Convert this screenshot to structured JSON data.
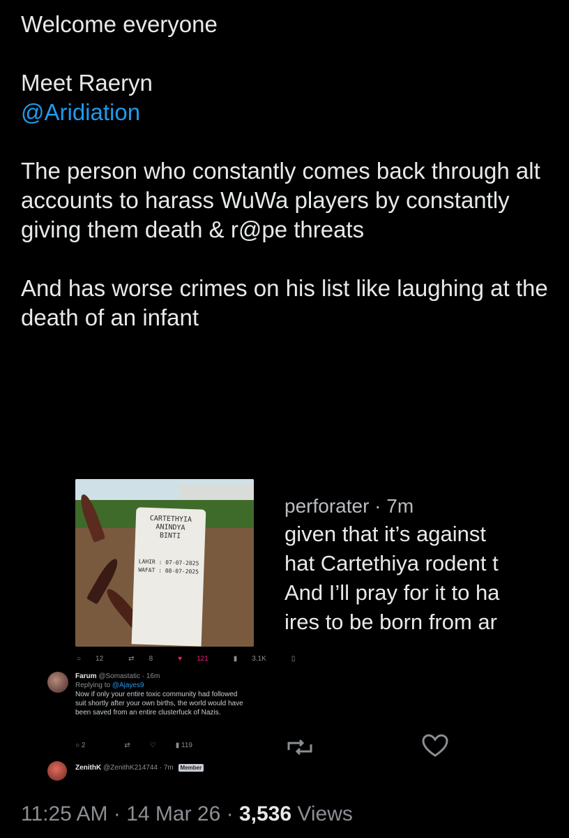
{
  "tweet": {
    "line1": "Welcome everyone",
    "line2": "Meet Raeryn",
    "mention": "@Aridiation",
    "para1": "The person who constantly comes back through alt accounts to harass WuWa players by constantly giving them death & r@pe threats",
    "para2": "And has worse crimes on his list like laughing at the death of an infant"
  },
  "embedded": {
    "gravestone": [
      "CARTETHYIA",
      "ANINDYA",
      "BINTI"
    ],
    "gravestone_dates": [
      "LAHIR : 07-07-2025",
      "WAFAT : 08-07-2025"
    ],
    "stats": {
      "replies": "12",
      "reposts": "8",
      "likes": "121",
      "views": "3.1K"
    },
    "reply": {
      "name": "Farum",
      "handle": "@Somastatic · 16m",
      "replying_label": "Replying to",
      "replying_handle": "@Ajayes9",
      "text": "Now if only your entire toxic community had followed suit shortly after your own births, the world would have been saved from an entire clusterfuck of Nazis."
    },
    "stats2": {
      "replies": "2",
      "views": "119"
    },
    "reply2": {
      "name": "ZenithK",
      "handle": "@ZenithK214744 · 7m",
      "badge": "Member"
    }
  },
  "side": {
    "meta": "perforater · 7m",
    "lines": [
      "given that it’s against",
      "hat Cartethiya rodent t",
      "And I’ll pray for it to ha",
      "ires to be born from ar"
    ]
  },
  "footer": {
    "time": "11:25 AM",
    "date": "14 Mar 26",
    "views_count": "3,536",
    "views_label": "Views"
  }
}
